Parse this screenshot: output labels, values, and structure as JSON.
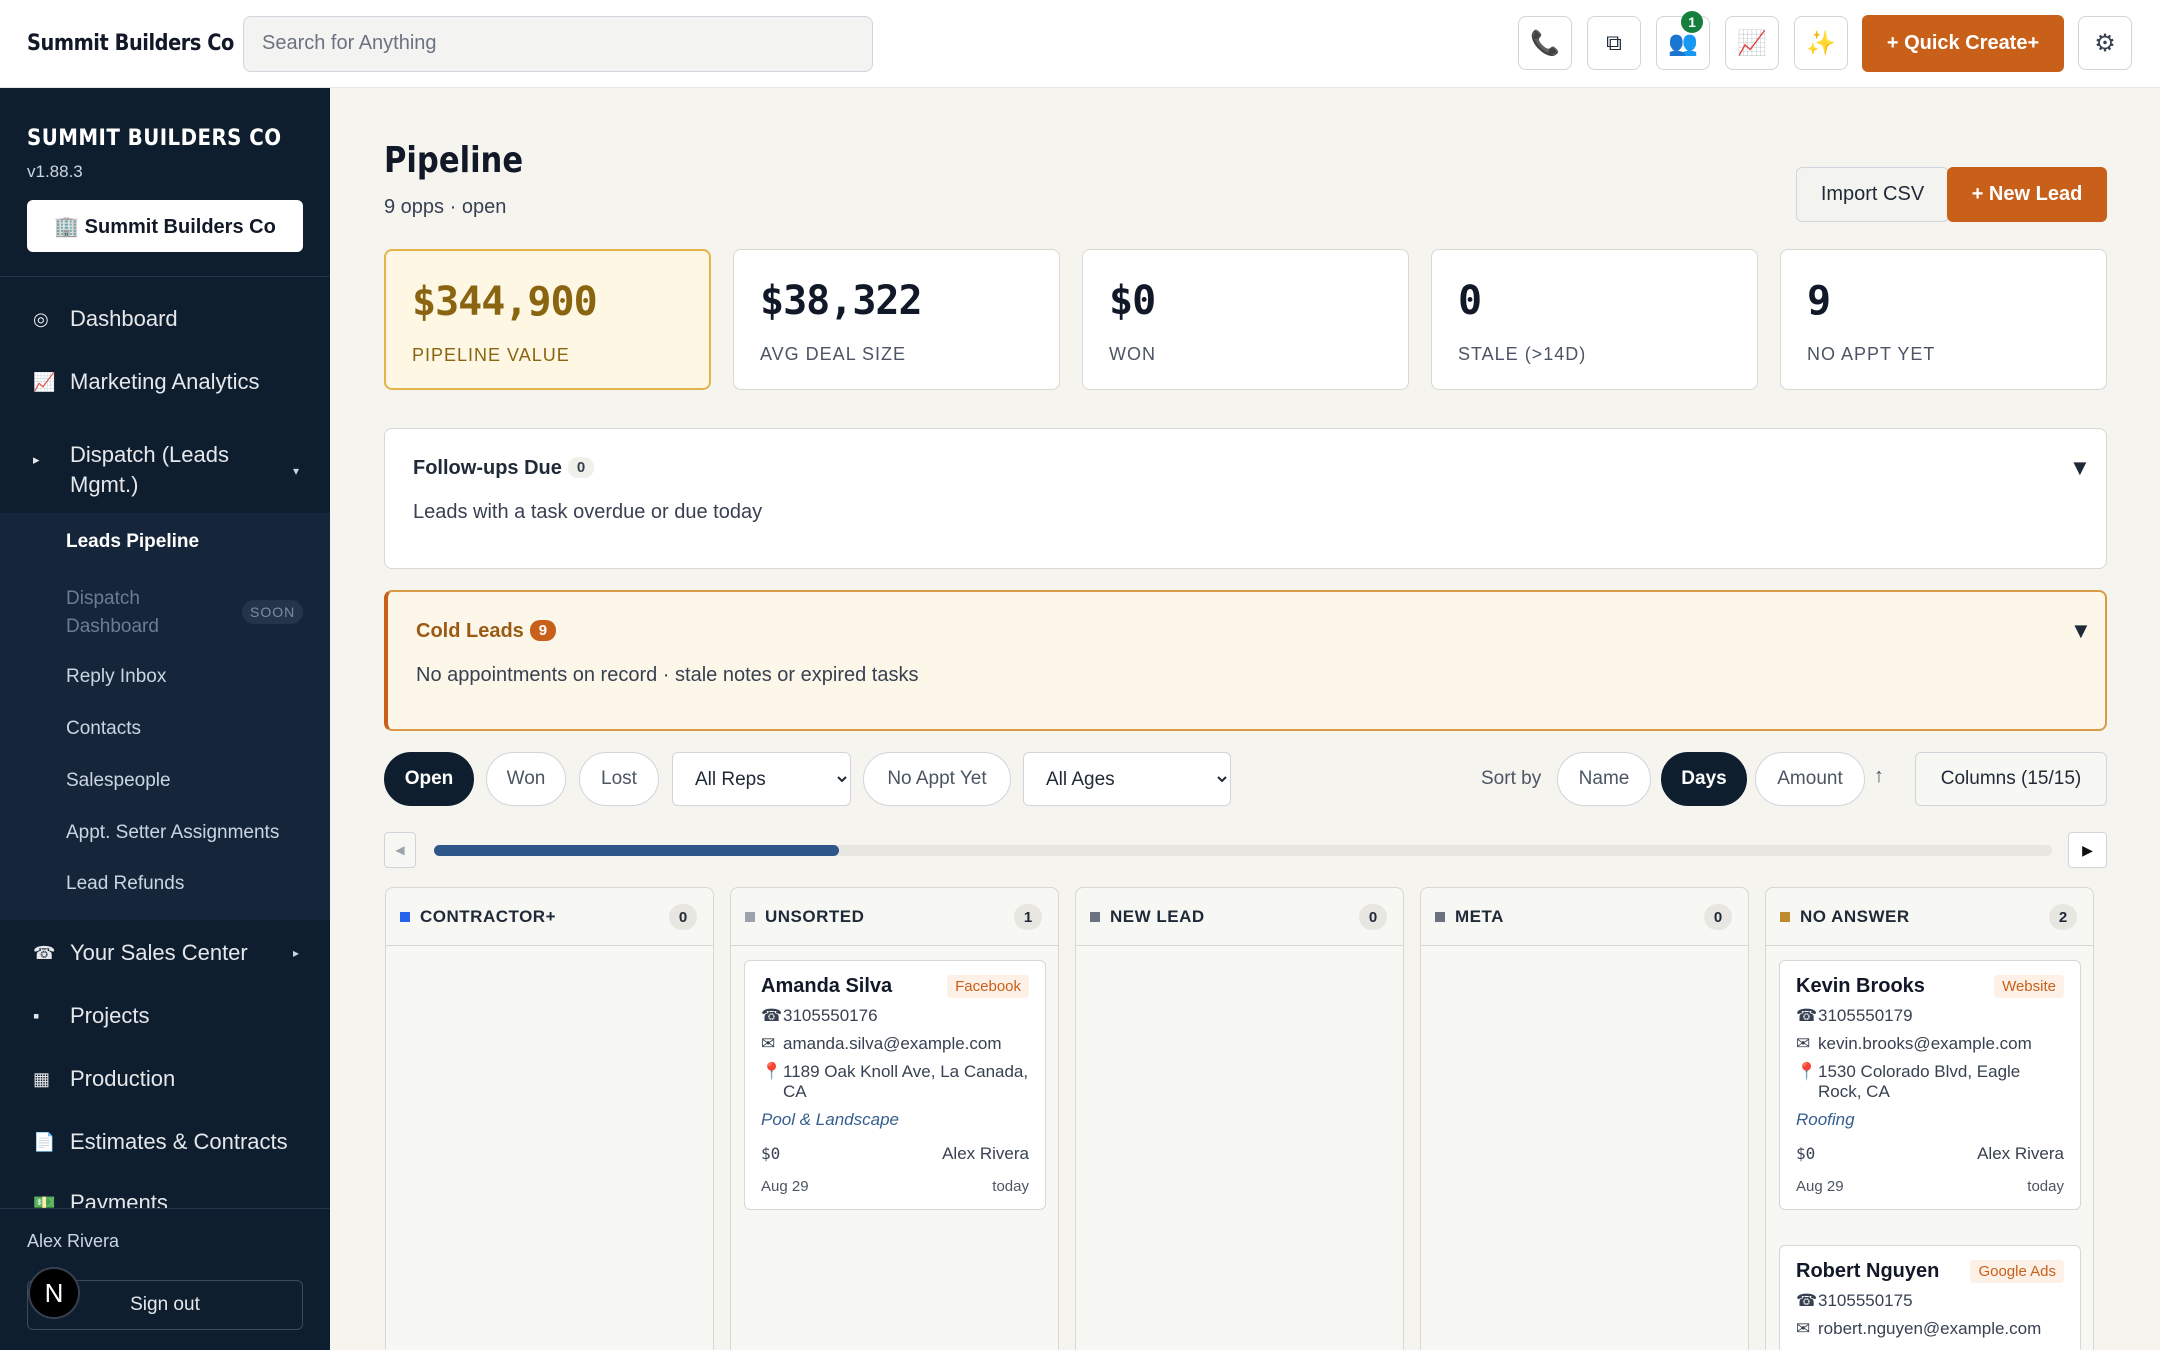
{
  "topbar": {
    "brand": "Summit Builders Co",
    "search_placeholder": "Search for Anything",
    "badge_count": "1",
    "quick_create_label": "+ Quick Create+"
  },
  "sidebar": {
    "title": "SUMMIT BUILDERS CO",
    "version": "v1.88.3",
    "org_button": "🏢 Summit Builders Co",
    "nav": [
      {
        "icon": "◎",
        "label": "Dashboard"
      },
      {
        "icon": "📈",
        "label": "Marketing Analytics"
      },
      {
        "icon": "▸",
        "label": "Dispatch (Leads Mgmt.)"
      },
      {
        "icon": "☎",
        "label": "Your Sales Center"
      },
      {
        "icon": "▪",
        "label": "Projects"
      },
      {
        "icon": "▦",
        "label": "Production"
      },
      {
        "icon": "📄",
        "label": "Estimates & Contracts"
      },
      {
        "icon": "💵",
        "label": "Payments"
      }
    ],
    "sub": [
      "Leads Pipeline",
      "Dispatch Dashboard",
      "Reply Inbox",
      "Contacts",
      "Salespeople",
      "Appt. Setter Assignments",
      "Lead Refunds"
    ],
    "soon_label": "SOON",
    "user_name": "Alex Rivera",
    "sign_out": "Sign out",
    "avatar_letter": "N"
  },
  "page": {
    "title": "Pipeline",
    "subtitle": "9 opps · open",
    "import_label": "Import CSV",
    "new_lead_label": "+ New Lead"
  },
  "stats": [
    {
      "value": "$344,900",
      "label": "PIPELINE VALUE"
    },
    {
      "value": "$38,322",
      "label": "AVG DEAL SIZE"
    },
    {
      "value": "$0",
      "label": "WON"
    },
    {
      "value": "0",
      "label": "STALE (>14D)"
    },
    {
      "value": "9",
      "label": "NO APPT YET"
    }
  ],
  "followups": {
    "title": "Follow-ups Due",
    "count": "0",
    "desc": "Leads with a task overdue or due today"
  },
  "cold": {
    "title": "Cold Leads",
    "count": "9",
    "desc": "No appointments on record · stale notes or expired tasks"
  },
  "filters": {
    "open": "Open",
    "won": "Won",
    "lost": "Lost",
    "reps": "All Reps",
    "noappt": "No Appt Yet",
    "ages": "All Ages",
    "sort_by": "Sort by",
    "sort_name": "Name",
    "sort_days": "Days",
    "sort_amount": "Amount",
    "columns": "Columns (15/15)",
    "scroll_progress": 0.25
  },
  "columns": [
    {
      "name": "CONTRACTOR+",
      "count": "0",
      "color": "#2563eb"
    },
    {
      "name": "UNSORTED",
      "count": "1",
      "color": "#9ca3af"
    },
    {
      "name": "NEW LEAD",
      "count": "0",
      "color": "#6b7280"
    },
    {
      "name": "META",
      "count": "0",
      "color": "#6b7280"
    },
    {
      "name": "NO ANSWER",
      "count": "2",
      "color": "#c08a2e"
    }
  ],
  "cards": {
    "amanda": {
      "name": "Amanda Silva",
      "source": "Facebook",
      "phone": "3105550176",
      "email": "amanda.silva@example.com",
      "address": "1189 Oak Knoll Ave, La Canada, CA",
      "service": "Pool & Landscape",
      "amount": "$0",
      "rep": "Alex Rivera",
      "date": "Aug 29",
      "age": "today"
    },
    "kevin": {
      "name": "Kevin Brooks",
      "source": "Website",
      "phone": "3105550179",
      "email": "kevin.brooks@example.com",
      "address": "1530 Colorado Blvd, Eagle Rock, CA",
      "service": "Roofing",
      "amount": "$0",
      "rep": "Alex Rivera",
      "date": "Aug 29",
      "age": "today"
    },
    "robert": {
      "name": "Robert Nguyen",
      "source": "Google Ads",
      "phone": "3105550175",
      "email": "robert.nguyen@example.com"
    }
  }
}
